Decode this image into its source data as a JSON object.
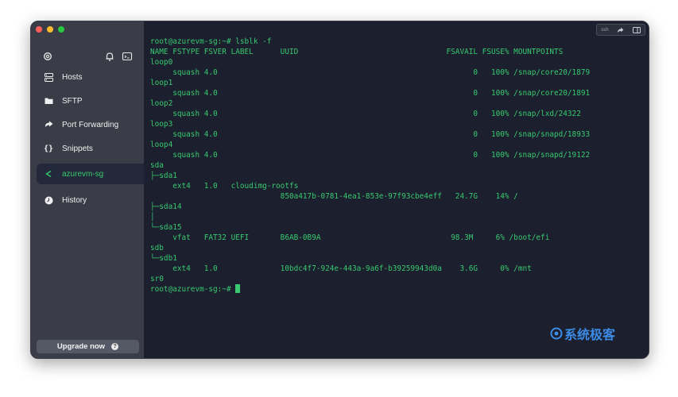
{
  "sidebar": {
    "nav": [
      {
        "label": "Hosts",
        "icon": "hosts-icon"
      },
      {
        "label": "SFTP",
        "icon": "folder-icon"
      },
      {
        "label": "Port Forwarding",
        "icon": "arrow-forward-icon"
      },
      {
        "label": "Snippets",
        "icon": "braces-icon"
      },
      {
        "label": "azurevm-sg",
        "icon": "terminal-chevron-icon"
      },
      {
        "label": "History",
        "icon": "clock-icon"
      }
    ],
    "upgrade_label": "Upgrade now",
    "upgrade_help": "?"
  },
  "terminal": {
    "toolbar_text": "ssh",
    "lines": [
      "root@azurevm-sg:~# lsblk -f",
      "NAME FSTYPE FSVER LABEL      UUID                                 FSAVAIL FSUSE% MOUNTPOINTS",
      "loop0",
      "     squash 4.0                                                         0   100% /snap/core20/1879",
      "loop1",
      "     squash 4.0                                                         0   100% /snap/core20/1891",
      "loop2",
      "     squash 4.0                                                         0   100% /snap/lxd/24322",
      "loop3",
      "     squash 4.0                                                         0   100% /snap/snapd/18933",
      "loop4",
      "     squash 4.0                                                         0   100% /snap/snapd/19122",
      "sda",
      "├─sda1",
      "     ext4   1.0   cloudimg-rootfs",
      "                             850a417b-0781-4ea1-853e-97f93cbe4eff   24.7G    14% /",
      "├─sda14",
      "│",
      "└─sda15",
      "     vfat   FAT32 UEFI       B6AB-0B9A                             98.3M     6% /boot/efi",
      "sdb",
      "└─sdb1",
      "     ext4   1.0              10bdc4f7-924e-443a-9a6f-b39259943d0a    3.6G     0% /mnt",
      "sr0",
      "root@azurevm-sg:~# "
    ]
  },
  "watermark": "系统极客",
  "colors": {
    "sidebar_bg": "#3a3d47",
    "terminal_bg": "#1b1f2e",
    "terminal_text": "#39c96f",
    "watermark": "#3c8be6"
  }
}
